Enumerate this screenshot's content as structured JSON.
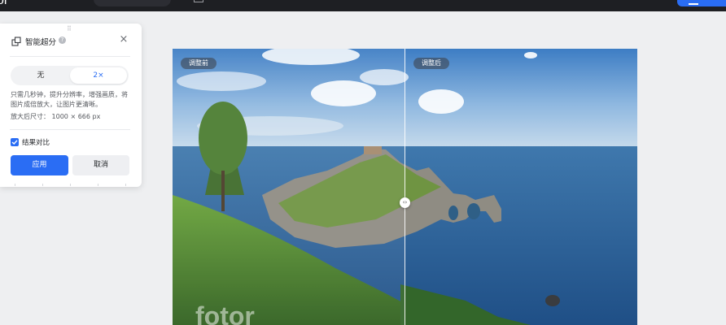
{
  "topbar": {
    "logo_fragment": "or"
  },
  "panel": {
    "title": "智能超分",
    "help_glyph": "?",
    "close_glyph": "×",
    "drag_glyph": "⠿",
    "options": [
      {
        "label": "无",
        "selected": false
      },
      {
        "label": "2×",
        "selected": true
      }
    ],
    "description": "只需几秒钟，提升分辨率，增强画质，将图片成倍放大，让图片更清晰。",
    "size_text": "放大后尺寸： 1000 × 666 px",
    "compare_label": "结果对比",
    "compare_checked": true,
    "apply_label": "应用",
    "cancel_label": "取消"
  },
  "canvas": {
    "before_label": "调整前",
    "after_label": "调整后",
    "handle_glyph": "‹›",
    "watermark": "fotor"
  },
  "colors": {
    "accent": "#2a6df4",
    "topbar": "#1e1f23",
    "background": "#eeeff1"
  }
}
